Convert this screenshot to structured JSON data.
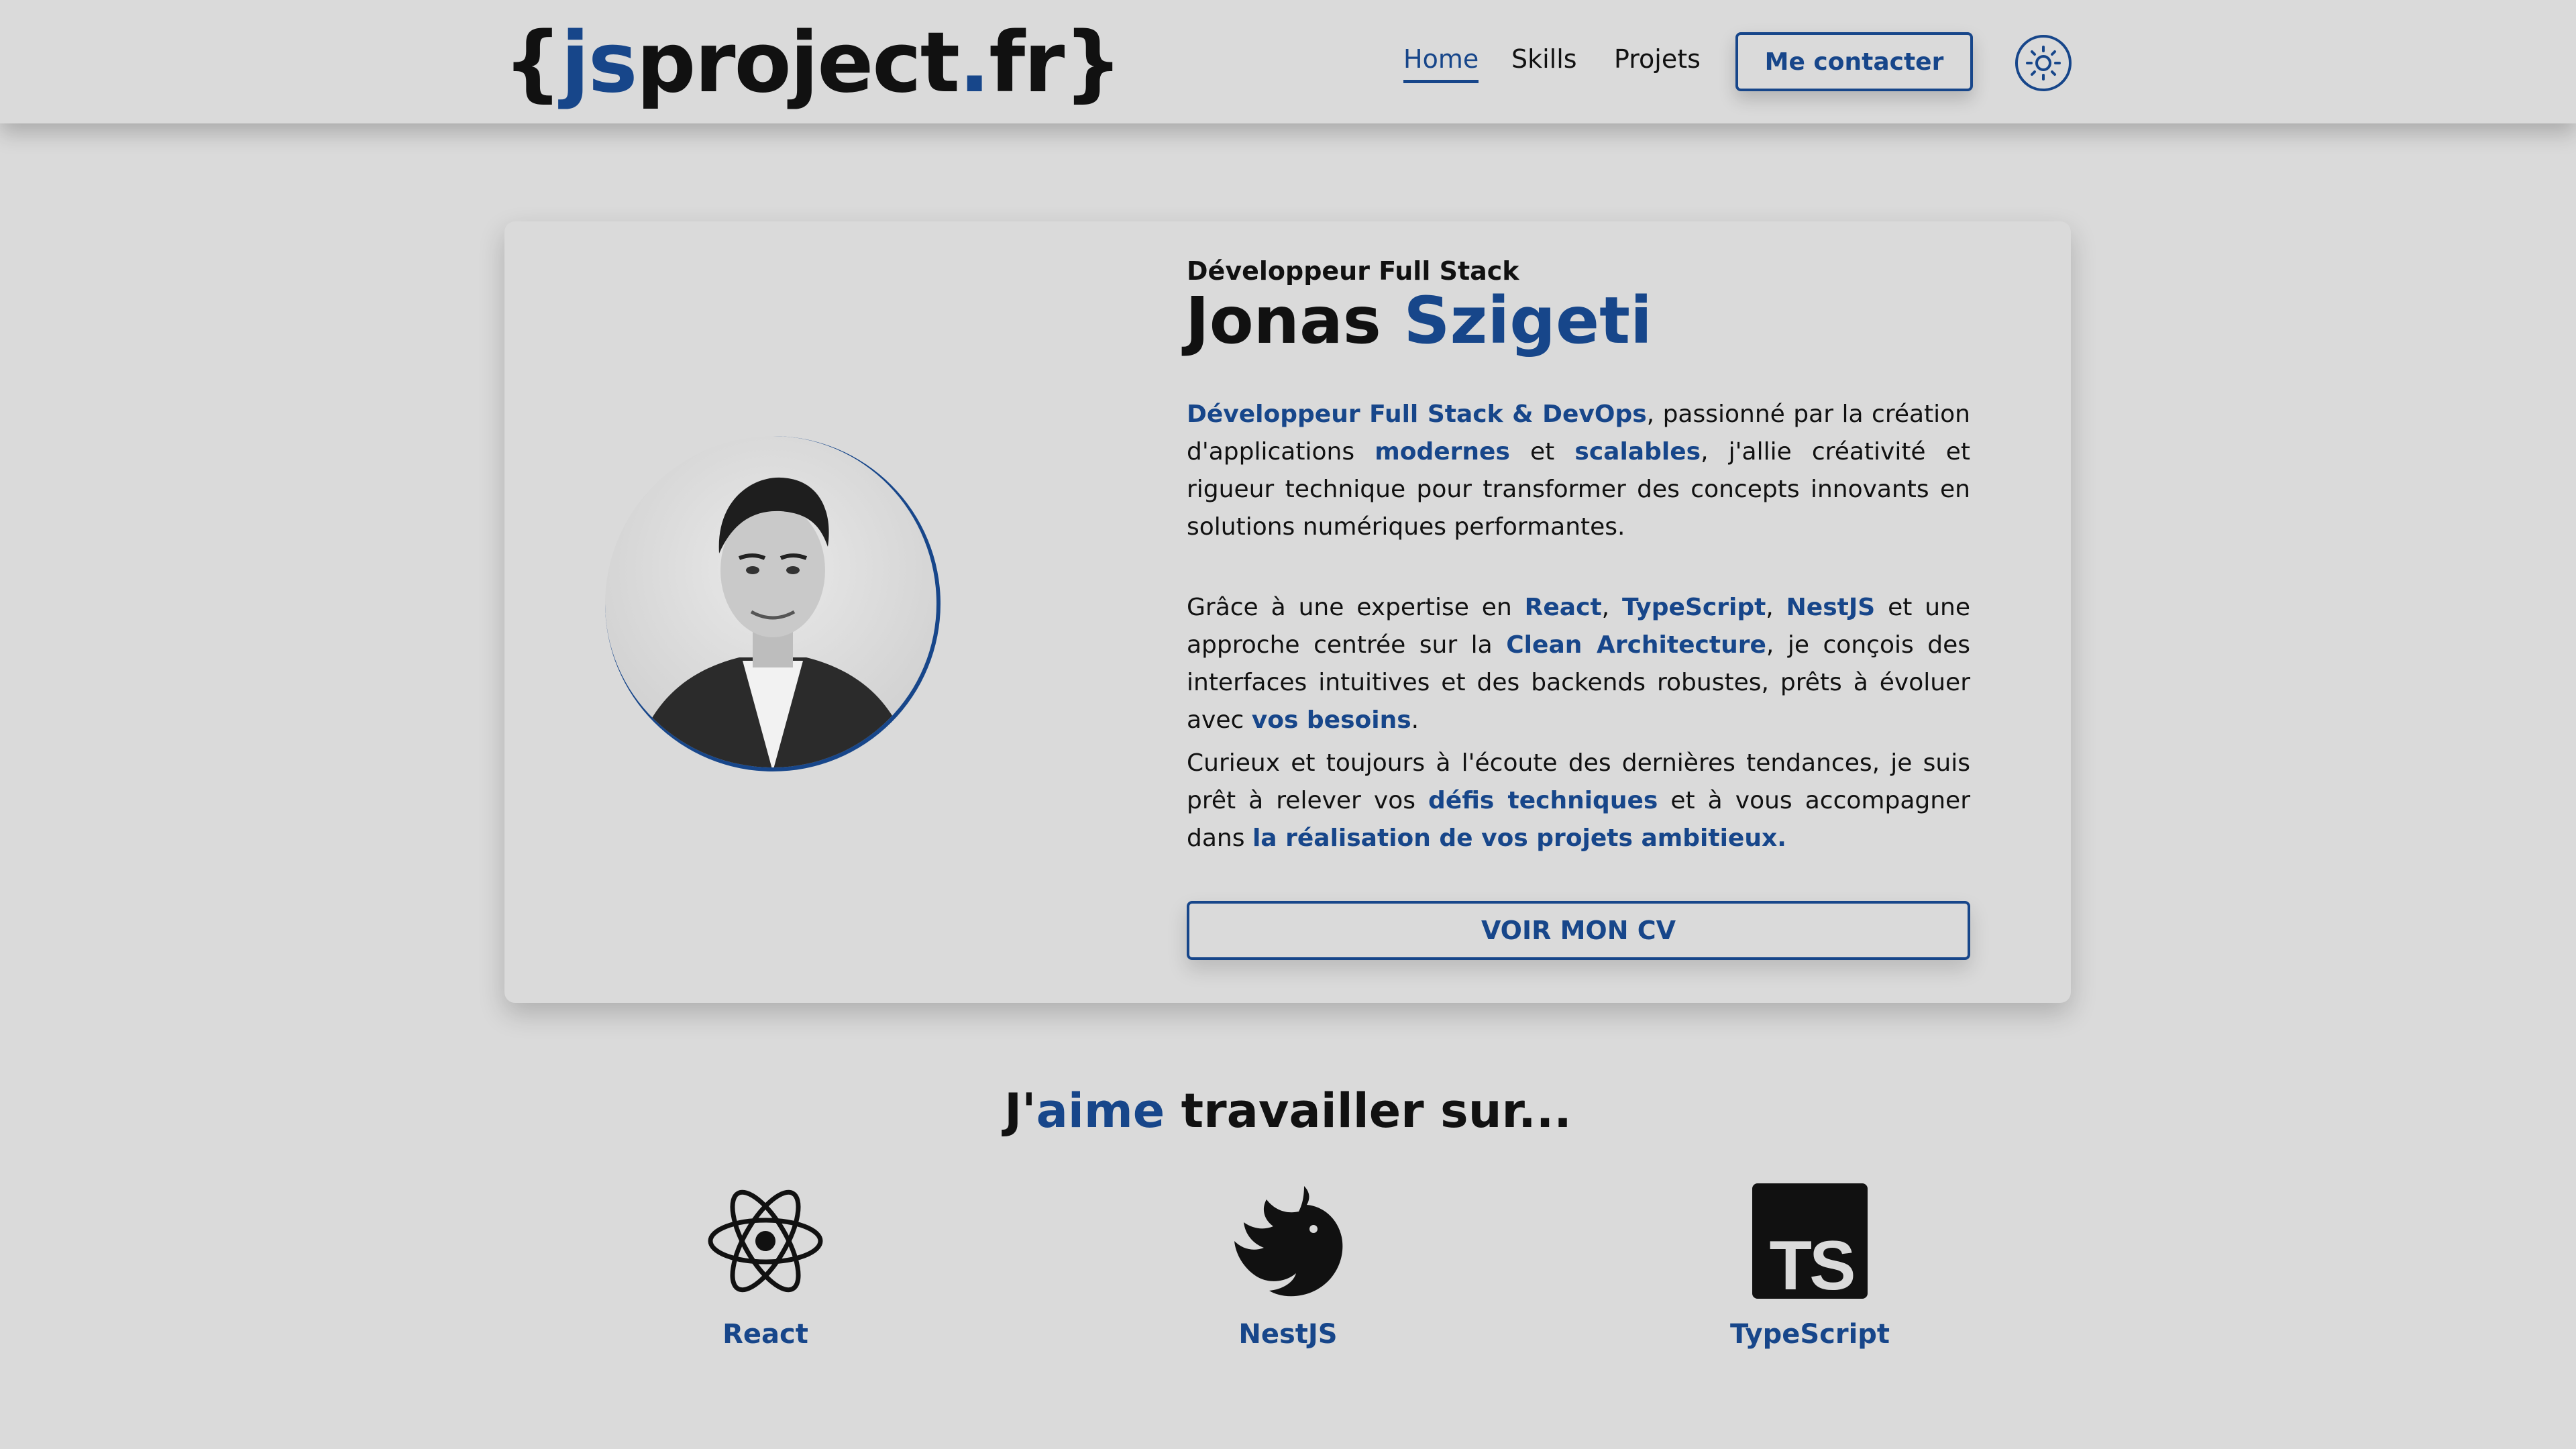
{
  "header": {
    "logo": {
      "brace_open": "{",
      "js": "js",
      "project": "project",
      "dot": ".",
      "fr": "fr",
      "brace_close": "}"
    },
    "nav": [
      {
        "label": "Home",
        "active": true
      },
      {
        "label": "Skills",
        "active": false
      },
      {
        "label": "Projets",
        "active": false
      }
    ],
    "contact_label": "Me contacter",
    "theme_icon": "sun-icon"
  },
  "hero": {
    "subtitle": "Développeur Full Stack",
    "first_name": "Jonas",
    "last_name": "Szigeti",
    "p1": {
      "hl1": "Développeur Full Stack & DevOps",
      "t1": ", passionné par la création d'applications ",
      "hl2": "modernes",
      "t2": " et ",
      "hl3": "scalables",
      "t3": ", j'allie créativité et rigueur technique pour transformer des concepts innovants en solutions numériques performantes."
    },
    "p2": {
      "t1": "Grâce à une expertise en ",
      "hl1": "React",
      "t2": ", ",
      "hl2": "TypeScript",
      "t3": ", ",
      "hl3": "NestJS",
      "t4": " et une approche centrée sur la ",
      "hl4": "Clean Architecture",
      "t5": ", je conçois des interfaces intuitives et des backends robustes, prêts à évoluer avec ",
      "hl5": "vos besoins",
      "t6": "."
    },
    "p3": {
      "t1": "Curieux et toujours à l'écoute des dernières tendances, je suis prêt à relever vos ",
      "hl1": "défis techniques",
      "t2": " et à vous accompagner dans ",
      "hl2": "la réalisation de vos projets ambitieux."
    },
    "cv_label": "VOIR MON CV"
  },
  "skills": {
    "title_pre": "J'",
    "title_hl": "aime",
    "title_post": " travailler sur...",
    "items": [
      {
        "label": "React",
        "icon": "react-icon"
      },
      {
        "label": "NestJS",
        "icon": "nestjs-icon"
      },
      {
        "label": "TypeScript",
        "icon": "typescript-icon"
      }
    ]
  },
  "colors": {
    "accent": "#17468a",
    "background": "#dadada",
    "text": "#111111"
  }
}
